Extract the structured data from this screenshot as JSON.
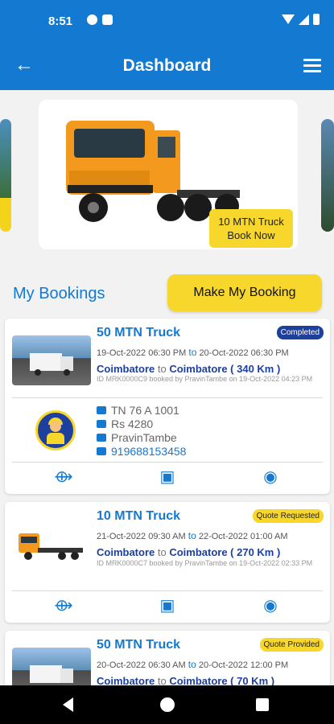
{
  "status_bar": {
    "time": "8:51"
  },
  "app_bar": {
    "title": "Dashboard"
  },
  "carousel": {
    "badge_line1": "10 MTN Truck",
    "badge_line2": "Book Now"
  },
  "bookings": {
    "title": "My Bookings",
    "make_booking_label": "Make My Booking"
  },
  "cards": [
    {
      "title": "50 MTN Truck",
      "status": "Completed",
      "from_date": "19-Oct-2022 06:30 PM",
      "to_word": "to",
      "to_date": "20-Oct-2022 06:30 PM",
      "from_city": "Coimbatore",
      "to_city": "Coimbatore ( 340 Km )",
      "meta": "ID MRK0000C9 booked by PravinTambe on 19-Oct-2022 04:23 PM",
      "vehicle_no": "TN 76 A 1001",
      "amount": "Rs 4280",
      "driver": "PravinTambe",
      "phone": "919688153458"
    },
    {
      "title": "10 MTN Truck",
      "status": "Quote Requested",
      "from_date": "21-Oct-2022 09:30 AM",
      "to_word": "to",
      "to_date": "22-Oct-2022 01:00 AM",
      "from_city": "Coimbatore",
      "to_city": "Coimbatore ( 270 Km )",
      "meta": "ID MRK0000C7 booked by PravinTambe on 19-Oct-2022 02:33 PM"
    },
    {
      "title": "50 MTN Truck",
      "status": "Quote Provided",
      "from_date": "20-Oct-2022 06:30 AM",
      "to_word": "to",
      "to_date": "20-Oct-2022 12:00 PM",
      "from_city": "Coimbatore",
      "to_city": "Coimbatore ( 70 Km )"
    }
  ],
  "colors": {
    "primary": "#1479d0",
    "accent": "#f7d72c",
    "dark_blue": "#1d3f9e"
  },
  "icons": [
    "back-arrow-icon",
    "menu-icon",
    "truck-icon",
    "money-icon",
    "person-icon",
    "phone-icon",
    "share-icon",
    "add-image-icon",
    "eye-icon"
  ]
}
